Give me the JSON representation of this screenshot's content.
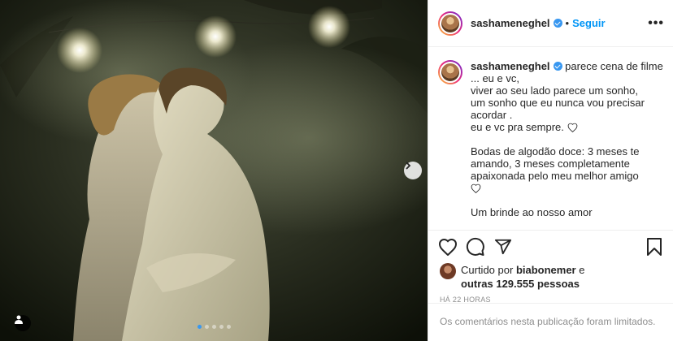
{
  "post": {
    "username": "sashameneghel",
    "follow_label": "Seguir",
    "separator": "•",
    "more_label": "•••",
    "caption": "parece cena de filme ... eu e vc,\nviver ao seu lado parece um sonho,\num sonho que eu nunca vou precisar acordar .\neu e vc pra sempre.",
    "caption_part2": "Bodas de algodão doce: 3 meses te amando, 3 meses completamente apaixonada pelo meu melhor amigo",
    "caption_cutoff": "Um brinde ao nosso amor",
    "liked_by_prefix": "Curtido por",
    "liked_by_user": "biabonemer",
    "liked_by_suffix": "e",
    "likes_count_text": "outras 129.555 pessoas",
    "time_ago": "HÁ 22 HORAS",
    "comments_limited": "Os comentários nesta publicação foram limitados.",
    "carousel": {
      "total": 5,
      "active_index": 0
    }
  },
  "icons": {
    "verified": "verified-badge-icon",
    "like": "heart-icon",
    "comment": "comment-icon",
    "share": "share-icon",
    "save": "bookmark-icon",
    "next": "chevron-right-icon",
    "user_tag": "person-icon"
  },
  "colors": {
    "accent": "#0095f6",
    "verified": "#3897f0",
    "muted": "#8e8e8e",
    "text": "#262626"
  }
}
